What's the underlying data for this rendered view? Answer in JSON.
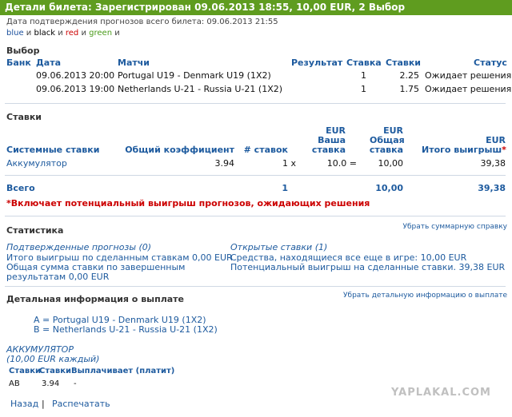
{
  "title": "Детали билета: Зарегистрирован 09.06.2013 18:55, 10,00 EUR, 2 Выбор",
  "confirm_date": "Дата подтверждения прогнозов всего билета: 09.06.2013 21:55",
  "colors_line": {
    "blue": "blue",
    "and1": " и ",
    "black": "black",
    "and2": " и ",
    "red": "red",
    "and3": " и ",
    "green": "green",
    "and4": " и"
  },
  "choice": {
    "section": "Выбор",
    "headers": {
      "bank": "Банк",
      "date": "Дата",
      "matches": "Матчи",
      "result": "Результат",
      "stake": "Ставка",
      "odds": "Ставки",
      "status": "Статус"
    },
    "rows": [
      {
        "date": "09.06.2013 20:00",
        "match": "Portugal U19 - Denmark U19 (1X2)",
        "stake": "1",
        "odds": "2.25",
        "status": "Ожидает решения"
      },
      {
        "date": "09.06.2013 19:00",
        "match": "Netherlands U-21 - Russia U-21 (1X2)",
        "stake": "1",
        "odds": "1.75",
        "status": "Ожидает решения"
      }
    ]
  },
  "bets": {
    "section": "Ставки",
    "headers": {
      "system": "Системные ставки",
      "coef": "Общий коэффициент",
      "count": "# ставок",
      "your_cur": "EUR",
      "your1": "Ваша",
      "your2": "ставка",
      "total_cur": "EUR",
      "total1": "Общая",
      "total2": "ставка",
      "win_cur": "EUR",
      "win": "Итого выигрыш",
      "win_star": "*"
    },
    "row": {
      "name": "Аккумулятор",
      "coef": "3.94",
      "count": "1 x",
      "stake": "10.0 =",
      "total": "10,00",
      "win": "39,38"
    },
    "total_row": {
      "label": "Всего",
      "count": "1",
      "total": "10,00",
      "win": "39,38"
    },
    "note": "*Включает потенциальный выигрыш прогнозов, ожидающих решения"
  },
  "stats": {
    "section": "Статистика",
    "remove_link": "Убрать суммарную справку",
    "confirmed": "Подтвержденные прогнозы (0)",
    "open": "Открытые ставки (1)",
    "l1": "Итого выигрыш по сделанным ставкам 0,00 EUR",
    "l2": "Общая сумма ставки по завершенным",
    "l3": "результатам 0,00 EUR",
    "r1": "Средства, находящиеся все еще в игре: 10,00 EUR",
    "r2": "Потенциальный выигрыш на сделанные ставки. 39,38 EUR"
  },
  "payout": {
    "section": "Детальная информация о выплате",
    "remove_link": "Убрать детальную информацию о выплате",
    "a": "A = Portugal U19 - Denmark U19 (1X2)",
    "b": "B = Netherlands U-21 - Russia U-21 (1X2)",
    "acc": "АККУМУЛЯТОР",
    "acc_sub": "(10,00 EUR каждый)",
    "h1": "Ставки",
    "h2": "Ставки",
    "h3": "Выплачивает (платит)",
    "c1": "AB",
    "c2": "3.94",
    "c3": "-"
  },
  "footer": {
    "back": "Назад",
    "sep": "|",
    "print": "Распечатать"
  },
  "watermark": "YAPLAKAL.COM"
}
